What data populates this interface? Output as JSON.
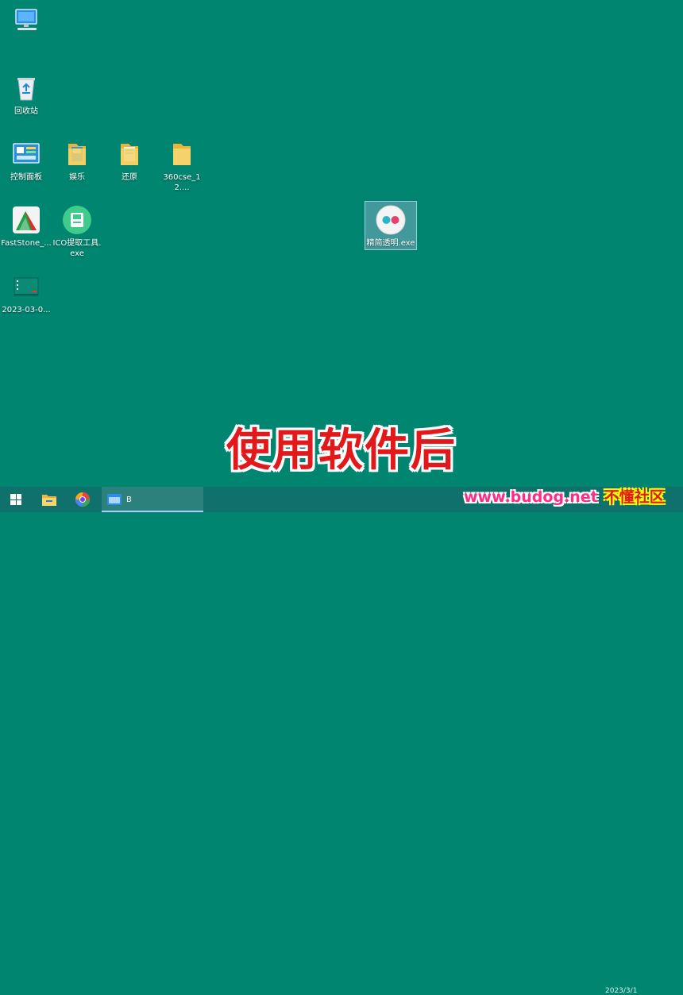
{
  "desktop": {
    "icons": [
      {
        "name": "computer-icon",
        "label": ""
      },
      {
        "name": "recycle-bin-icon",
        "label": "回收站"
      },
      {
        "name": "control-panel-icon",
        "label": "控制面板"
      },
      {
        "name": "folder-icon",
        "label": "娱乐"
      },
      {
        "name": "folder-icon",
        "label": "还原"
      },
      {
        "name": "folder-icon",
        "label": "360cse_12...."
      },
      {
        "name": "faststone-icon",
        "label": "FastStone_..."
      },
      {
        "name": "ico-tool-icon",
        "label": "ICO提取工具.exe"
      },
      {
        "name": "screenshot-file-icon",
        "label": "2023-03-0..."
      },
      {
        "name": "app-exe-icon",
        "label": "精简透明.exe"
      }
    ]
  },
  "caption": "使用软件后",
  "taskbar": {
    "active_label": "B",
    "clock": "2023/3/1"
  },
  "watermark": {
    "url": "www.budog.net",
    "brand": "不懂社区"
  }
}
